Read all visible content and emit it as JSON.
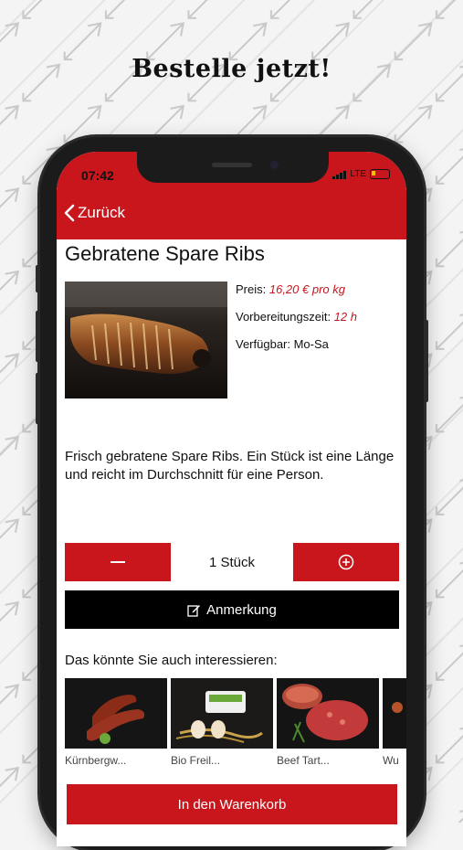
{
  "headline": "Bestelle jetzt!",
  "status_bar": {
    "time": "07:42",
    "network": "LTE"
  },
  "nav": {
    "back_label": "Zurück"
  },
  "product": {
    "title": "Gebratene Spare Ribs",
    "price_label": "Preis:",
    "price_value": "16,20 € pro kg",
    "prep_label": "Vorbereitungszeit:",
    "prep_value": "12 h",
    "availability": "Verfügbar: Mo-Sa",
    "description": "Frisch gebratene Spare Ribs. Ein Stück ist eine Länge und reicht im Durchschnitt für eine Person."
  },
  "quantity": {
    "text": "1 Stück"
  },
  "note_button": {
    "label": "Anmerkung"
  },
  "related": {
    "heading": "Das könnte Sie auch interessieren:",
    "items": [
      {
        "label": "Kürnbergw..."
      },
      {
        "label": "Bio Freil..."
      },
      {
        "label": "Beef Tart..."
      },
      {
        "label": "Wu"
      }
    ]
  },
  "cart_button": {
    "label": "In den Warenkorb"
  },
  "colors": {
    "accent": "#c8161c",
    "dark": "#000000"
  }
}
